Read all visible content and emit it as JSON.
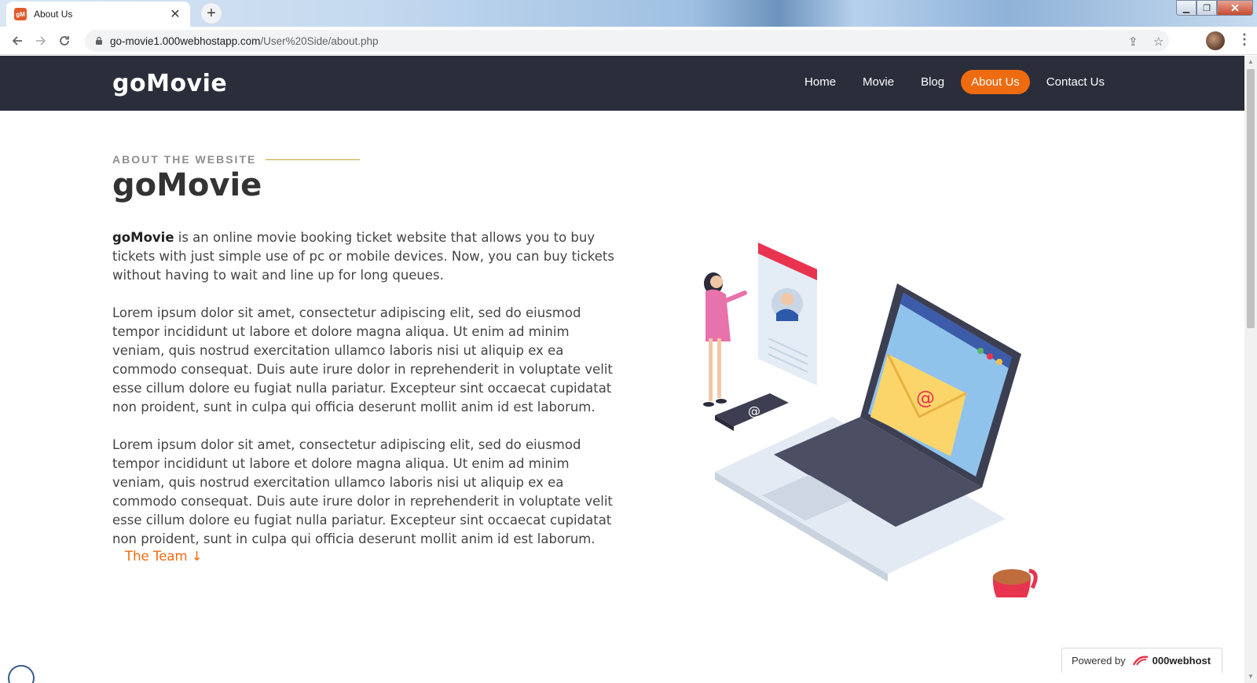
{
  "browser": {
    "tab_title": "About Us",
    "favicon_text": "gM",
    "url_host": "go-movie1.000webhostapp.com",
    "url_path": "/User%20Side/about.php"
  },
  "site": {
    "brand": "goMovie",
    "nav": [
      {
        "label": "Home",
        "active": false
      },
      {
        "label": "Movie",
        "active": false
      },
      {
        "label": "Blog",
        "active": false
      },
      {
        "label": "About Us",
        "active": true
      },
      {
        "label": "Contact Us",
        "active": false
      }
    ],
    "eyebrow": "ABOUT THE WEBSITE",
    "heading": "goMovie",
    "intro_bold": "goMovie",
    "intro_rest": " is an online movie booking ticket website that allows you to buy tickets with just simple use of pc or mobile devices. Now, you can buy tickets without having to wait and line up for long queues.",
    "paragraph_2": "Lorem ipsum dolor sit amet, consectetur adipiscing elit, sed do eiusmod tempor incididunt ut labore et dolore magna aliqua. Ut enim ad minim veniam, quis nostrud exercitation ullamco laboris nisi ut aliquip ex ea commodo consequat. Duis aute irure dolor in reprehenderit in voluptate velit esse cillum dolore eu fugiat nulla pariatur. Excepteur sint occaecat cupidatat non proident, sunt in culpa qui officia deserunt mollit anim id est laborum.",
    "paragraph_3": "Lorem ipsum dolor sit amet, consectetur adipiscing elit, sed do eiusmod tempor incididunt ut labore et dolore magna aliqua. Ut enim ad minim veniam, quis nostrud exercitation ullamco laboris nisi ut aliquip ex ea commodo consequat. Duis aute irure dolor in reprehenderit in voluptate velit esse cillum dolore eu fugiat nulla pariatur. Excepteur sint occaecat cupidatat non proident, sunt in culpa qui officia deserunt mollit anim id est laborum.",
    "team_link": "The Team ↓",
    "powered_label": "Powered by",
    "powered_brand": "000webhost",
    "colors": {
      "header_bg": "#2a2d3a",
      "accent": "#ef6b10",
      "eyebrow_line": "#c9a13c"
    }
  },
  "icons": [
    "favicon-icon",
    "close-icon",
    "plus-icon",
    "back-icon",
    "forward-icon",
    "reload-icon",
    "lock-icon",
    "share-icon",
    "star-icon",
    "profile-avatar",
    "menu-icon",
    "minimize-icon",
    "maximize-icon",
    "window-close-icon"
  ]
}
